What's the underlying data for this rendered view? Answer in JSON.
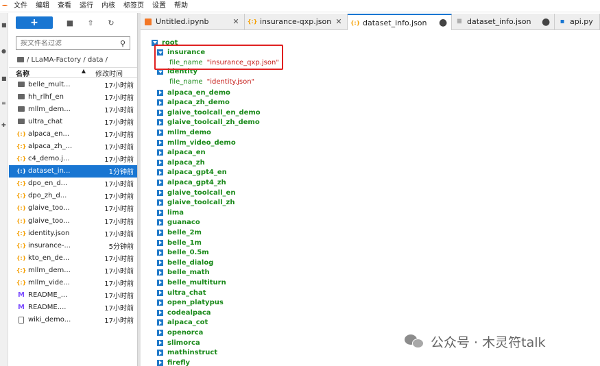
{
  "menu": [
    "文件",
    "编辑",
    "查看",
    "运行",
    "内核",
    "标签页",
    "设置",
    "帮助"
  ],
  "filebrowser": {
    "search_placeholder": "按文件名过滤",
    "path": "/ LLaMA-Factory / data /",
    "col_name": "名称",
    "col_modified": "修改时间",
    "files": [
      {
        "name": "belle_mult...",
        "type": "folder",
        "time": "17小时前"
      },
      {
        "name": "hh_rlhf_en",
        "type": "folder",
        "time": "17小时前"
      },
      {
        "name": "mllm_dem...",
        "type": "folder",
        "time": "17小时前"
      },
      {
        "name": "ultra_chat",
        "type": "folder",
        "time": "17小时前"
      },
      {
        "name": "alpaca_en...",
        "type": "json",
        "time": "17小时前"
      },
      {
        "name": "alpaca_zh_...",
        "type": "json",
        "time": "17小时前"
      },
      {
        "name": "c4_demo.j...",
        "type": "json",
        "time": "17小时前"
      },
      {
        "name": "dataset_in...",
        "type": "json",
        "time": "1分钟前",
        "selected": true
      },
      {
        "name": "dpo_en_d...",
        "type": "json",
        "time": "17小时前"
      },
      {
        "name": "dpo_zh_d...",
        "type": "json",
        "time": "17小时前"
      },
      {
        "name": "glaive_too...",
        "type": "json",
        "time": "17小时前"
      },
      {
        "name": "glaive_too...",
        "type": "json",
        "time": "17小时前"
      },
      {
        "name": "identity.json",
        "type": "json",
        "time": "17小时前"
      },
      {
        "name": "insurance-...",
        "type": "json",
        "time": "5分钟前"
      },
      {
        "name": "kto_en_de...",
        "type": "json",
        "time": "17小时前"
      },
      {
        "name": "mllm_dem...",
        "type": "json",
        "time": "17小时前"
      },
      {
        "name": "mllm_vide...",
        "type": "json",
        "time": "17小时前"
      },
      {
        "name": "README_...",
        "type": "md",
        "time": "17小时前"
      },
      {
        "name": "README....",
        "type": "md",
        "time": "17小时前"
      },
      {
        "name": "wiki_demo...",
        "type": "file",
        "time": "17小时前"
      }
    ]
  },
  "tabs": [
    {
      "name": "Untitled.ipynb",
      "icon": "notebook-icon",
      "state": "close"
    },
    {
      "name": "insurance-qxp.json",
      "icon": "json-icon",
      "state": "close"
    },
    {
      "name": "dataset_info.json",
      "icon": "json-icon",
      "state": "dirty",
      "active": true
    },
    {
      "name": "dataset_info.json",
      "icon": "doc-icon",
      "state": "dirty"
    },
    {
      "name": "api.py",
      "icon": "python-icon",
      "state": "none"
    }
  ],
  "tree": {
    "root": "root",
    "insurance": {
      "key": "insurance",
      "field_key": "file_name",
      "field_value": "\"insurance_qxp.json\""
    },
    "identity": {
      "key": "identity",
      "field_key": "file_name",
      "field_value": "\"identity.json\""
    },
    "collapsed": [
      "alpaca_en_demo",
      "alpaca_zh_demo",
      "glaive_toolcall_en_demo",
      "glaive_toolcall_zh_demo",
      "mllm_demo",
      "mllm_video_demo",
      "alpaca_en",
      "alpaca_zh",
      "alpaca_gpt4_en",
      "alpaca_gpt4_zh",
      "glaive_toolcall_en",
      "glaive_toolcall_zh",
      "lima",
      "guanaco",
      "belle_2m",
      "belle_1m",
      "belle_0.5m",
      "belle_dialog",
      "belle_math",
      "belle_multiturn",
      "ultra_chat",
      "open_platypus",
      "codealpaca",
      "alpaca_cot",
      "openorca",
      "slimorca",
      "mathinstruct",
      "firefly"
    ]
  },
  "watermark": "公众号 · 木灵符talk",
  "colors": {
    "accent": "#1976d2",
    "key": "#1a8a1a",
    "string": "#c41a16",
    "highlight": "#e02020"
  }
}
